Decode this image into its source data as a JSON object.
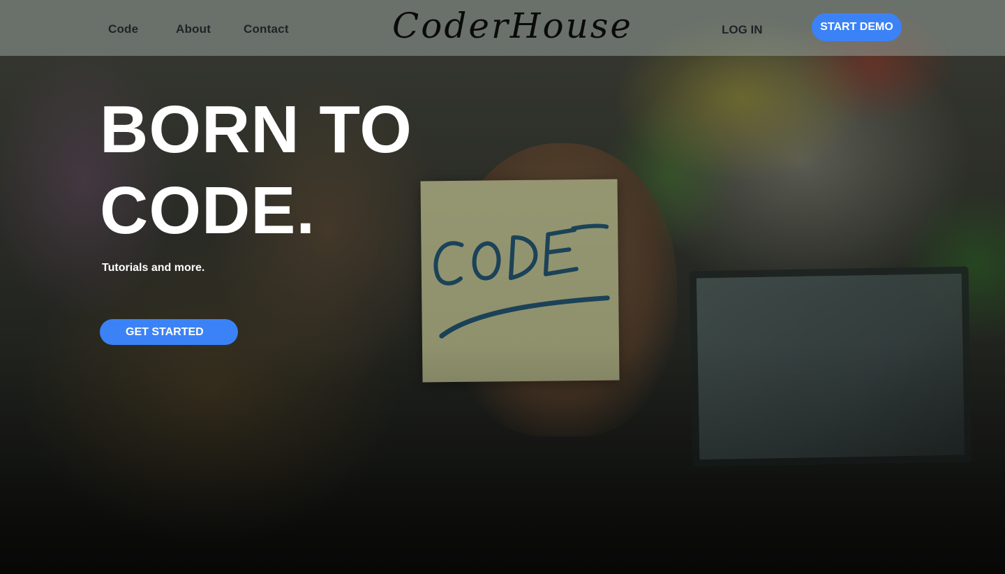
{
  "header": {
    "nav": [
      {
        "label": "Code"
      },
      {
        "label": "About"
      },
      {
        "label": "Contact"
      }
    ],
    "logo_text": "CoderHouse",
    "login_label": "LOG IN",
    "demo_label": "START DEMO"
  },
  "hero": {
    "headline_line1": "BORN TO",
    "headline_line2": "CODE.",
    "tagline": "Tutorials and more.",
    "cta_label": "GET STARTED",
    "note_text": "CODE"
  },
  "colors": {
    "accent": "#3b82f6",
    "header_bg": "#96a09b",
    "text_dark": "#1f2328",
    "text_light": "#ffffff"
  },
  "icons": {
    "background_image": "person-holding-sticky-note-image"
  }
}
